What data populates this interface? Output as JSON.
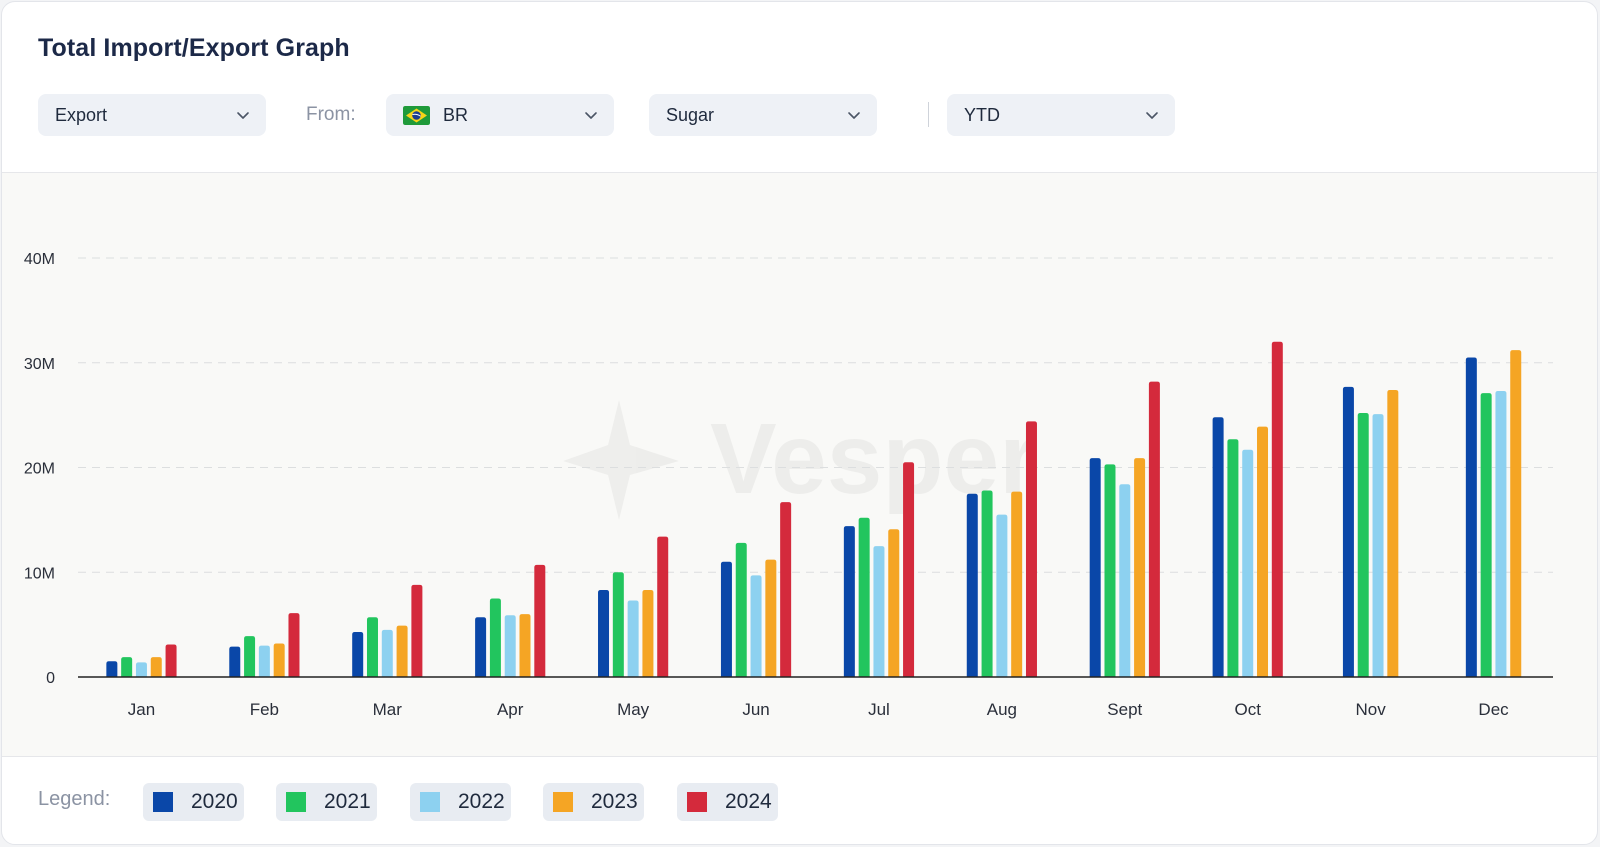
{
  "header": {
    "title": "Total Import/Export Graph"
  },
  "filters": {
    "flow": "Export",
    "from_label": "From:",
    "country": "BR",
    "country_flag": "brazil-flag-icon",
    "commodity": "Sugar",
    "period": "YTD"
  },
  "legend": {
    "label": "Legend:",
    "items": [
      {
        "name": "2020",
        "color": "#0a47a8"
      },
      {
        "name": "2021",
        "color": "#22c55e"
      },
      {
        "name": "2022",
        "color": "#8dd1f0"
      },
      {
        "name": "2023",
        "color": "#f5a524"
      },
      {
        "name": "2024",
        "color": "#d42a3c"
      }
    ]
  },
  "watermark": {
    "text": "Vesper",
    "icon": "sparkle-icon"
  },
  "colors": {
    "grid": "#dcdedf",
    "axis": "#222222",
    "tick_text": "#2a2f3a"
  },
  "chart_data": {
    "type": "bar",
    "categories": [
      "Jan",
      "Feb",
      "Mar",
      "Apr",
      "May",
      "Jun",
      "Jul",
      "Aug",
      "Sept",
      "Oct",
      "Nov",
      "Dec"
    ],
    "ylim": [
      0,
      40000000
    ],
    "yticks": [
      0,
      10000000,
      20000000,
      30000000,
      40000000
    ],
    "ytick_labels": [
      "0",
      "10M",
      "20M",
      "30M",
      "40M"
    ],
    "grid": true,
    "legend_position": "bottom",
    "series": [
      {
        "name": "2020",
        "values": [
          1500000,
          2900000,
          4300000,
          5700000,
          8300000,
          11000000,
          14400000,
          17500000,
          20900000,
          24800000,
          27700000,
          30500000
        ]
      },
      {
        "name": "2021",
        "values": [
          1900000,
          3900000,
          5700000,
          7500000,
          10000000,
          12800000,
          15200000,
          17800000,
          20300000,
          22700000,
          25200000,
          27100000
        ]
      },
      {
        "name": "2022",
        "values": [
          1400000,
          3000000,
          4500000,
          5900000,
          7300000,
          9700000,
          12500000,
          15500000,
          18400000,
          21700000,
          25100000,
          27300000
        ]
      },
      {
        "name": "2023",
        "values": [
          1900000,
          3200000,
          4900000,
          6000000,
          8300000,
          11200000,
          14100000,
          17700000,
          20900000,
          23900000,
          27400000,
          31200000
        ]
      },
      {
        "name": "2024",
        "values": [
          3100000,
          6100000,
          8800000,
          10700000,
          13400000,
          16700000,
          20500000,
          24400000,
          28200000,
          32000000,
          null,
          null
        ]
      }
    ]
  }
}
